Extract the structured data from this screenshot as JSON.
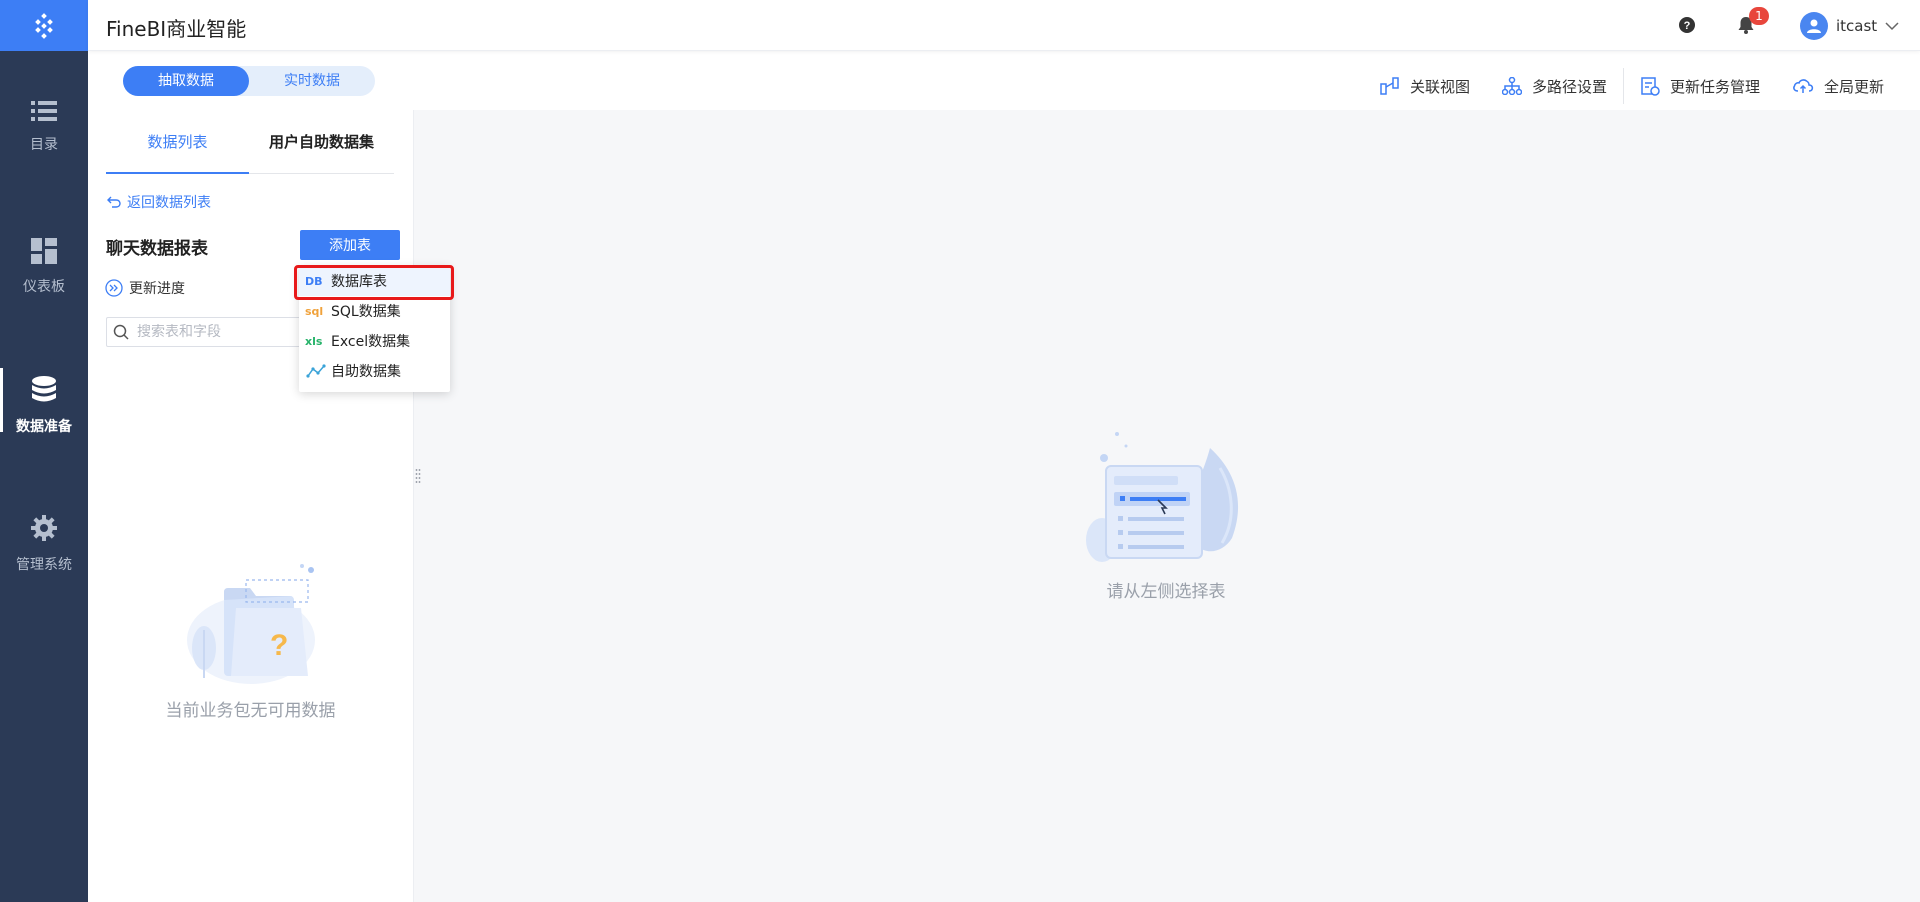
{
  "app": {
    "title": "FineBI商业智能"
  },
  "header": {
    "notification_count": "1",
    "username": "itcast"
  },
  "sidebar": {
    "items": [
      {
        "label": "目录",
        "icon": "list-icon"
      },
      {
        "label": "仪表板",
        "icon": "dashboard-icon"
      },
      {
        "label": "数据准备",
        "icon": "database-icon",
        "active": true
      },
      {
        "label": "管理系统",
        "icon": "gear-icon"
      }
    ]
  },
  "mode_switch": {
    "options": [
      "抽取数据",
      "实时数据"
    ],
    "selected": "抽取数据"
  },
  "toolbar": {
    "actions": [
      {
        "label": "关联视图",
        "icon": "relation-view-icon"
      },
      {
        "label": "多路径设置",
        "icon": "multipath-icon"
      },
      {
        "label": "更新任务管理",
        "icon": "task-manage-icon"
      },
      {
        "label": "全局更新",
        "icon": "cloud-update-icon"
      }
    ]
  },
  "panel": {
    "tabs": [
      "数据列表",
      "用户自助数据集"
    ],
    "active_tab": "数据列表",
    "back_link": "返回数据列表",
    "package_title": "聊天数据报表",
    "add_table_button": "添加表",
    "update_progress": "更新进度",
    "search_placeholder": "搜索表和字段",
    "empty_text": "当前业务包无可用数据"
  },
  "dropdown": {
    "items": [
      {
        "label": "数据库表",
        "icon": "db-icon",
        "badge": "DB",
        "color": "#3d7ef5",
        "highlighted": true
      },
      {
        "label": "SQL数据集",
        "icon": "sql-icon",
        "badge": "sql",
        "color": "#f0a23b"
      },
      {
        "label": "Excel数据集",
        "icon": "excel-icon",
        "badge": "xls",
        "color": "#27b36a"
      },
      {
        "label": "自助数据集",
        "icon": "self-service-icon",
        "badge": "",
        "color": "#3aa3d8"
      }
    ]
  },
  "content": {
    "empty_text": "请从左侧选择表"
  },
  "colors": {
    "primary": "#3d7ef5",
    "nav_bg": "#2b3a56",
    "highlight_frame": "#e8191a"
  }
}
